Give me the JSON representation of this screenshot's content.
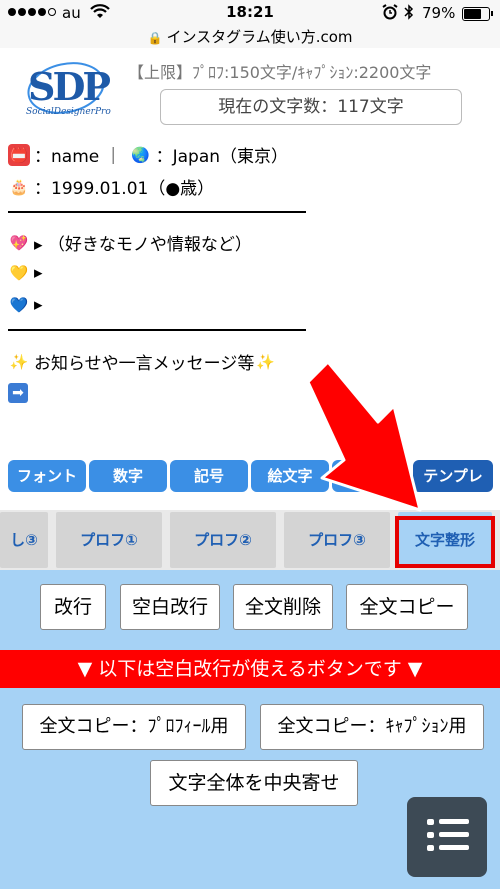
{
  "status_bar": {
    "carrier": "au",
    "time": "18:21",
    "battery_percent": "79%",
    "battery_level": 0.79,
    "url": "インスタグラム使い方.com"
  },
  "header": {
    "logo_text": "SDP",
    "logo_subtitle": "SocialDesignerPro",
    "limit_text": "【上限】ﾌﾟﾛﾌ:150文字/ｷｬﾌﾟｼｮﾝ:2200文字",
    "char_count": "現在の文字数：117文字"
  },
  "editor": {
    "line_name": "：name ｜",
    "line_country": "：Japan（東京）",
    "line_birthday": "：1999.01.01（●歳）",
    "line_like_1": "▸ （好きなモノや情報など）",
    "line_like_2": "▸",
    "line_like_3": "▸",
    "line_message": "お知らせや一言メッセージ等"
  },
  "toolbar": {
    "font": "フォント",
    "number": "数字",
    "symbol": "記号",
    "emoji": "絵文字",
    "template": "テンプレ"
  },
  "tabs": {
    "profile_3_partial": "し③",
    "profile_1": "プロフ①",
    "profile_2": "プロフ②",
    "profile_3": "プロフ③",
    "text_format": "文字整形"
  },
  "actions": {
    "newline": "改行",
    "blank_newline": "空白改行",
    "delete_all": "全文削除",
    "copy_all": "全文コピー",
    "notice": "▼ 以下は空白改行が使えるボタンです ▼",
    "copy_profile": "全文コピー：ﾌﾟﾛﾌｨｰﾙ用",
    "copy_caption": "全文コピー：ｷｬﾌﾟｼｮﾝ用",
    "center_align": "文字全体を中央寄せ"
  },
  "colors": {
    "toolbar_blue": "#3b8fe5",
    "panel_blue": "#a6d2f5",
    "alert_red": "#ff0000",
    "logo_blue": "#1e5aa8"
  }
}
